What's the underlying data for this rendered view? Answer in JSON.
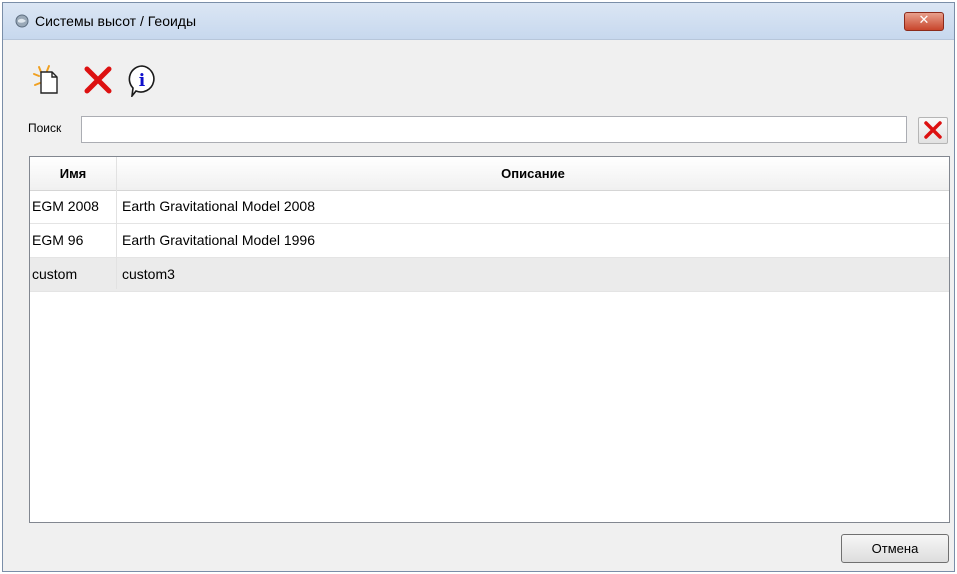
{
  "window": {
    "title": "Системы высот / Геоиды",
    "close_glyph": "✕"
  },
  "toolbar": {
    "buttons": [
      {
        "icon": "new-document-icon"
      },
      {
        "icon": "delete-icon",
        "color": "#dd1111"
      },
      {
        "icon": "info-icon",
        "color": "#1010cc",
        "glyph": "i"
      }
    ]
  },
  "search": {
    "label": "Поиск",
    "value": "",
    "placeholder": ""
  },
  "table": {
    "columns": [
      "Имя",
      "Описание"
    ],
    "rows": [
      {
        "name": "EGM 2008",
        "description": "Earth Gravitational Model 2008"
      },
      {
        "name": "EGM 96",
        "description": "Earth Gravitational Model 1996"
      },
      {
        "name": "custom",
        "description": "custom3"
      }
    ],
    "selected_row": 2
  },
  "footer": {
    "cancel_label": "Отмена"
  }
}
